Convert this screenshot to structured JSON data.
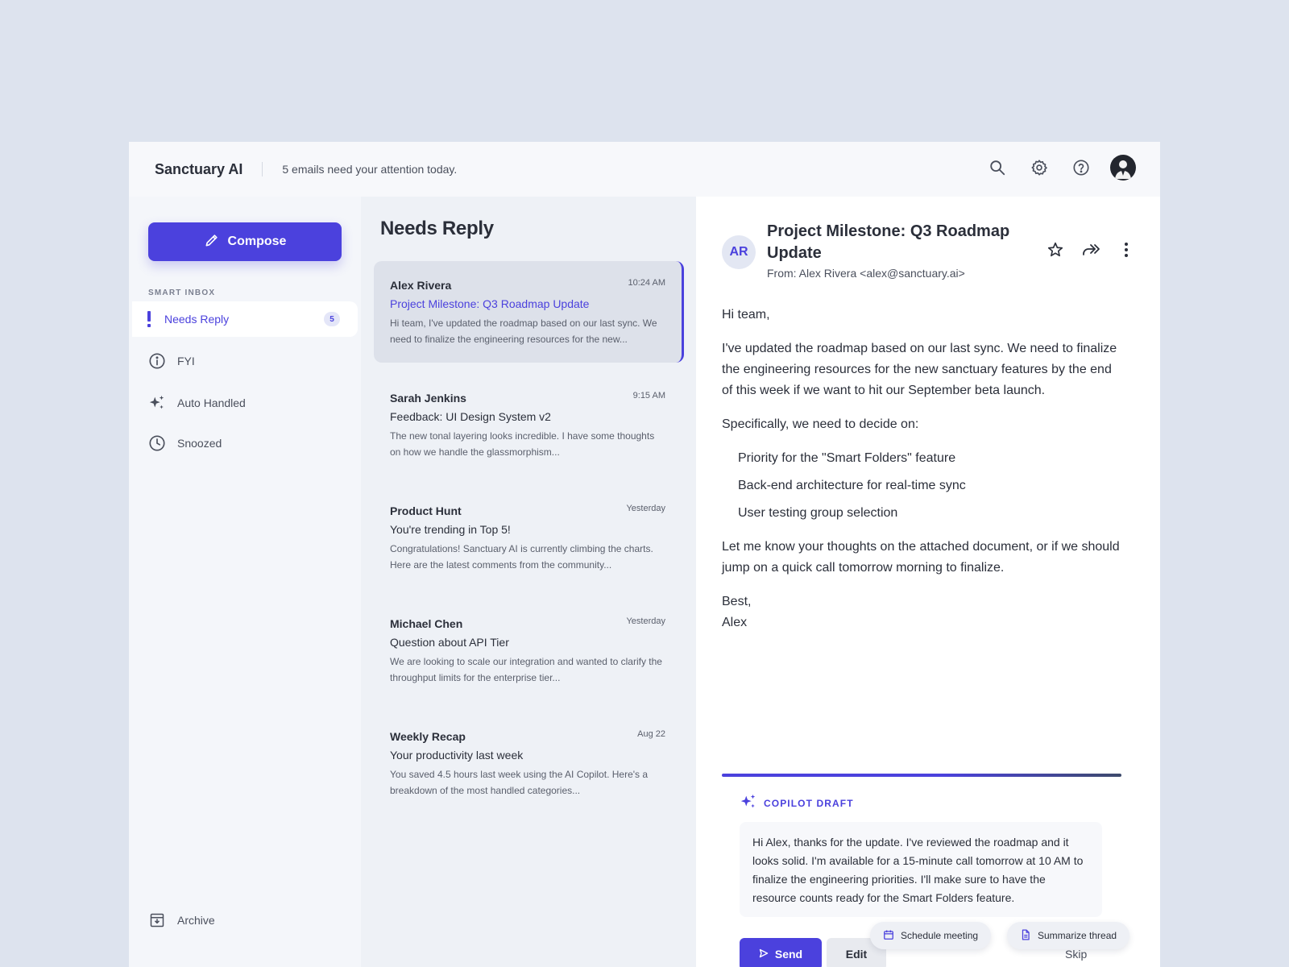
{
  "header": {
    "app_title": "Sanctuary AI",
    "tagline": "5 emails need your attention today.",
    "icons": [
      "search-icon",
      "gear-icon",
      "help-icon",
      "user-avatar"
    ]
  },
  "sidebar": {
    "compose_label": "Compose",
    "section_label": "SMART INBOX",
    "items": [
      {
        "label": "Needs Reply",
        "icon": "exclamation-icon",
        "badge": "5",
        "active": true
      },
      {
        "label": "FYI",
        "icon": "info-icon"
      },
      {
        "label": "Auto Handled",
        "icon": "sparkles-icon"
      },
      {
        "label": "Snoozed",
        "icon": "clock-icon"
      }
    ],
    "archive_label": "Archive"
  },
  "list": {
    "title": "Needs Reply",
    "emails": [
      {
        "sender": "Alex Rivera",
        "time": "10:24 AM",
        "subject": "Project Milestone: Q3 Roadmap Update",
        "preview": "Hi team, I've updated the roadmap based on our last sync. We need to finalize the engineering resources for the new..."
      },
      {
        "sender": "Sarah Jenkins",
        "time": "9:15 AM",
        "subject": "Feedback: UI Design System v2",
        "preview": "The new tonal layering looks incredible. I have some thoughts on how we handle the glassmorphism..."
      },
      {
        "sender": "Product Hunt",
        "time": "Yesterday",
        "subject": "You're trending in Top 5!",
        "preview": "Congratulations! Sanctuary AI is currently climbing the charts. Here are the latest comments from the community..."
      },
      {
        "sender": "Michael Chen",
        "time": "Yesterday",
        "subject": "Question about API Tier",
        "preview": "We are looking to scale our integration and wanted to clarify the throughput limits for the enterprise tier..."
      },
      {
        "sender": "Weekly Recap",
        "time": "Aug 22",
        "subject": "Your productivity last week",
        "preview": "You saved 4.5 hours last week using the AI Copilot. Here's a breakdown of the most handled categories..."
      }
    ]
  },
  "reader": {
    "avatar_initials": "AR",
    "subject": "Project Milestone: Q3 Roadmap Update",
    "from": "From: Alex Rivera <alex@sanctuary.ai>",
    "greeting": "Hi team,",
    "para1": "I've updated the roadmap based on our last sync. We need to finalize the engineering resources for the new sanctuary features by the end of this week if we want to hit our September beta launch.",
    "para2": "Specifically, we need to decide on:",
    "bullets": [
      "Priority for the \"Smart Folders\" feature",
      "Back-end architecture for real-time sync",
      "User testing group selection"
    ],
    "para3": "Let me know your thoughts on the attached document, or if we should jump on a quick call tomorrow morning to finalize.",
    "signoff": "Best,",
    "signature": "Alex"
  },
  "copilot": {
    "label": "COPILOT DRAFT",
    "draft": "Hi Alex, thanks for the update. I've reviewed the roadmap and it looks solid. I'm available for a 15-minute call tomorrow at 10 AM to finalize the engineering priorities. I'll make sure to have the resource counts ready for the Smart Folders feature.",
    "send_label": "Send",
    "edit_label": "Edit",
    "skip_label": "Skip",
    "chips": [
      "Schedule meeting",
      "Summarize thread"
    ]
  },
  "colors": {
    "accent": "#4b41dd",
    "background": "#dde3ee"
  }
}
